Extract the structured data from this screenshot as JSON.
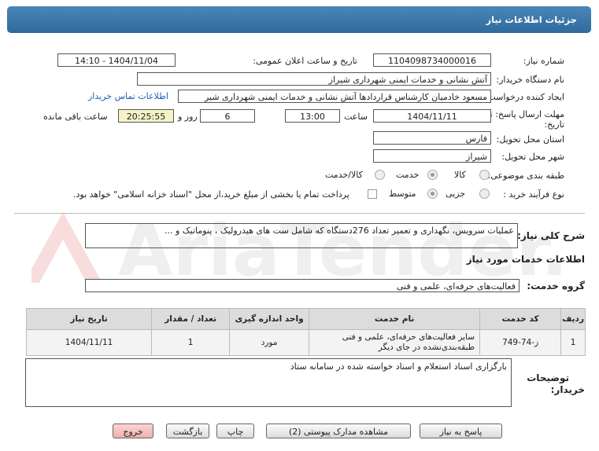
{
  "header": {
    "title": "جزئیات اطلاعات نیاز"
  },
  "fields": {
    "need_number_label": "شماره نیاز:",
    "need_number": "1104098734000016",
    "announce_label": "تاریخ و ساعت اعلان عمومی:",
    "announce_value": "1404/11/04 - 14:10",
    "buyer_label": "نام دستگاه خریدار:",
    "buyer_value": "آتش نشانی و خدمات ایمنی شهرداری شیراز",
    "creator_label": "ایجاد کننده درخواست:",
    "creator_value": "مسعود خادمیان کارشناس قراردادها آتش نشانی و خدمات ایمنی شهرداری شیر",
    "contact_link": "اطلاعات تماس خریدار",
    "deadline_label_1": "مهلت ارسال پاسخ: تا",
    "deadline_label_2": "تاریخ:",
    "deadline_date": "1404/11/11",
    "time_label": "ساعت",
    "deadline_time": "13:00",
    "days_value": "6",
    "days_label": "روز و",
    "remaining_time": "20:25:55",
    "remaining_label": "ساعت باقی مانده",
    "province_label": "استان محل تحویل:",
    "province_value": "فارس",
    "city_label": "شهر محل تحویل:",
    "city_value": "شیراز",
    "category_label": "طبقه بندی موضوعی:",
    "category_options": [
      "کالا",
      "خدمت",
      "کالا/خدمت"
    ],
    "process_label": "نوع فرآیند خرید :",
    "process_options": [
      "جزیی",
      "متوسط"
    ],
    "payment_note": "پرداخت تمام یا بخشی از مبلغ خرید،از محل \"اسناد خزانه اسلامی\" خواهد بود."
  },
  "summary": {
    "label": "شرح کلی نیاز:",
    "value": "عملیات سرویس، نگهداری و تعمیر تعداد 276دستگاه که شامل ست های هیدرولیک ، پنوماتیک و ..."
  },
  "services": {
    "section_title": "اطلاعات خدمات مورد نیاز",
    "group_label": "گروه خدمت:",
    "group_value": "فعالیت‌های حرفه‌ای، علمی و فنی"
  },
  "table": {
    "headers": [
      "ردیف",
      "کد خدمت",
      "نام خدمت",
      "واحد اندازه گیری",
      "تعداد / مقدار",
      "تاریخ نیاز"
    ],
    "rows": [
      [
        "1",
        "ز-74-749",
        "سایر فعالیت‌های حرفه‌ای، علمی و فنی طبقه‌بندی‌نشده در جای دیگر",
        "مورد",
        "1",
        "1404/11/11"
      ]
    ]
  },
  "notes": {
    "label_1": "توضیحات",
    "label_2": "خریدار:",
    "value": "بارگزاری اسناد استعلام و اسناد خواسته شده در سامانه ستاد"
  },
  "buttons": {
    "reply": "پاسخ به نیاز",
    "docs": "مشاهده مدارک پیوستی (2)",
    "print": "چاپ",
    "back": "بازگشت",
    "exit": "خروج"
  },
  "watermark": {
    "text": "AriaTender.net"
  },
  "colors": {
    "header": "#2f6a9c",
    "link": "#1a5fb4",
    "exit_button": "#f1aeae",
    "remaining_bg": "#f6f3c7"
  }
}
